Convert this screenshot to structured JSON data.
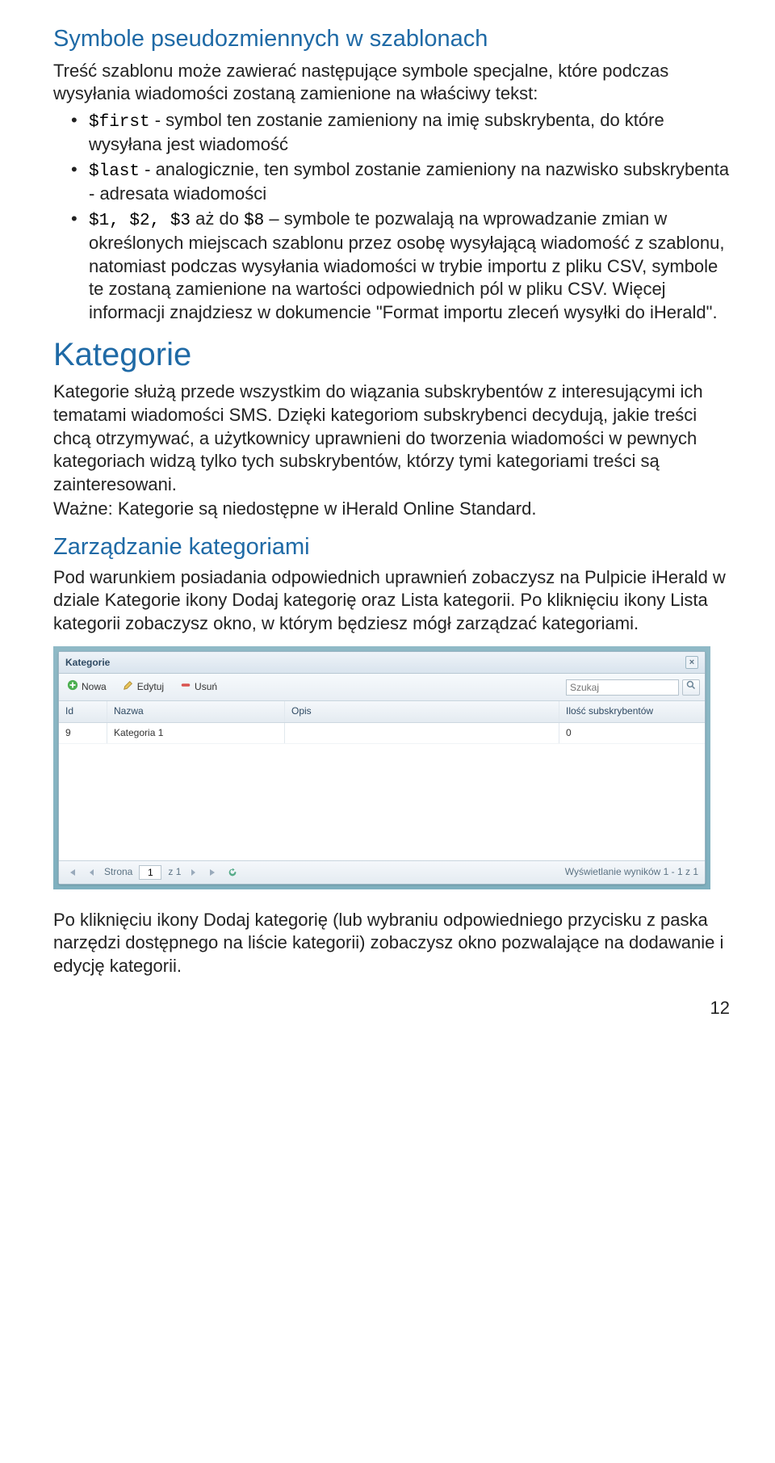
{
  "headings": {
    "symbole_title": "Symbole pseudozmiennych w szablonach",
    "kategorie": "Kategorie",
    "zarzadzanie": "Zarządzanie kategoriami"
  },
  "intro1": "Treść szablonu może zawierać następujące symbole specjalne, które podczas wysyłania wiadomości zostaną zamienione na właściwy tekst:",
  "bullets": {
    "first_code": "$first",
    "first_text": " - symbol ten zostanie zamieniony na imię subskrybenta, do które wysyłana jest wiadomość",
    "last_code": "$last",
    "last_text": " - analogicznie, ten symbol zostanie zamieniony na nazwisko subskrybenta - adresata wiadomości",
    "range_code": "$1, $2, $3",
    "range_text_a": " aż do ",
    "range_code2": "$8",
    "range_text_b": " – symbole te pozwalają na wprowadzanie zmian w określonych miejscach szablonu przez osobę wysyłającą wiadomość z szablonu, natomiast podczas wysyłania wiadomości w trybie importu z pliku CSV, symbole te zostaną zamienione na wartości odpowiednich pól w pliku CSV. Więcej informacji znajdziesz w dokumencie \"Format importu zleceń wysyłki do iHerald\"."
  },
  "kat_p1": "Kategorie służą przede wszystkim do wiązania subskrybentów z interesującymi ich tematami wiadomości SMS. Dzięki kategoriom subskrybenci decydują, jakie treści chcą otrzymywać, a użytkownicy uprawnieni do tworzenia wiadomości w pewnych kategoriach widzą tylko tych subskrybentów, którzy tymi kategoriami treści są zainteresowani.",
  "kat_p2": "Ważne: Kategorie są niedostępne w iHerald Online Standard.",
  "zarz_p1": "Pod warunkiem posiadania odpowiednich uprawnień zobaczysz na Pulpicie iHerald w dziale Kategorie ikony Dodaj kategorię oraz Lista kategorii. Po kliknięciu ikony Lista kategorii zobaczysz okno, w którym będziesz mógł zarządzać kategoriami.",
  "after_window": "Po kliknięciu ikony Dodaj kategorię (lub wybraniu odpowiedniego przycisku z paska narzędzi dostępnego na liście kategorii) zobaczysz okno pozwalające na dodawanie i edycję kategorii.",
  "page_number": "12",
  "window": {
    "title": "Kategorie",
    "toolbar": {
      "nowa": "Nowa",
      "edytuj": "Edytuj",
      "usun": "Usuń",
      "search_placeholder": "Szukaj"
    },
    "columns": {
      "id": "Id",
      "nazwa": "Nazwa",
      "opis": "Opis",
      "ilosc": "Ilość subskrybentów"
    },
    "rows": [
      {
        "id": "9",
        "nazwa": "Kategoria 1",
        "opis": "",
        "ilosc": "0"
      }
    ],
    "footer": {
      "strona_label": "Strona",
      "page_value": "1",
      "z_label": "z 1",
      "results": "Wyświetlanie wyników 1 - 1 z 1"
    }
  }
}
